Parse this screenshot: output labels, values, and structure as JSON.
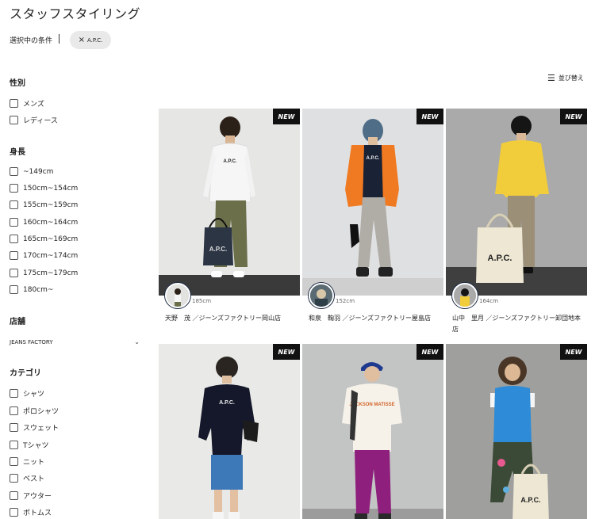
{
  "page": {
    "title": "スタッフスタイリング"
  },
  "conditions": {
    "label": "選択中の条件",
    "chip_label": "A.P.C."
  },
  "sort": {
    "label": "並び替え"
  },
  "filters": {
    "gender": {
      "title": "性別",
      "options": [
        "メンズ",
        "レディース"
      ]
    },
    "height": {
      "title": "身長",
      "options": [
        "~149cm",
        "150cm~154cm",
        "155cm~159cm",
        "160cm~164cm",
        "165cm~169cm",
        "170cm~174cm",
        "175cm~179cm",
        "180cm~"
      ]
    },
    "store": {
      "title": "店舗",
      "selected": "JEANS FACTORY"
    },
    "category": {
      "title": "カテゴリ",
      "options": [
        "シャツ",
        "ポロシャツ",
        "スウェット",
        "Tシャツ",
        "ニット",
        "ベスト",
        "アウター",
        "ボトムス"
      ]
    }
  },
  "badge_label": "NEW",
  "cards": [
    {
      "height": "185cm",
      "staff": "天野　茂 ／ジーンズファクトリー岡山店"
    },
    {
      "height": "152cm",
      "staff": "和泉　鞠羽 ／ジーンズファクトリー屋島店"
    },
    {
      "height": "164cm",
      "staff": "山中　里月 ／ジーンズファクトリー卸団地本店"
    },
    {
      "height": "",
      "staff": ""
    },
    {
      "height": "",
      "staff": ""
    },
    {
      "height": "",
      "staff": ""
    }
  ],
  "photo_logos": [
    "A.P.C.",
    "A.P.C.",
    "A.P.C.",
    "A.P.C.",
    "JACKSON MATISSE",
    "A.P.C."
  ],
  "colors": {
    "badge_bg": "#111111",
    "chip_bg": "#e9e9e9",
    "avatar_ring": "#1c2a44"
  }
}
